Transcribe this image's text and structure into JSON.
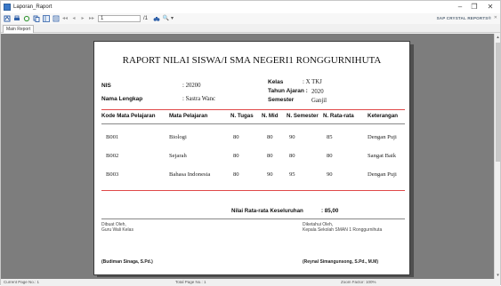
{
  "window": {
    "title": "Laporan_Raport",
    "minimize": "–",
    "maximize": "❐",
    "close": "✕"
  },
  "toolbar": {
    "page_value": "1",
    "page_total": "/1",
    "zoom_symbol": "🔍",
    "zoom_dropdown": "▾",
    "brand": "SAP CRYSTAL REPORTS®",
    "brand_close": "✕"
  },
  "tabs": [
    {
      "label": "Main Report"
    }
  ],
  "report": {
    "title": "RAPORT NILAI SISWA/I SMA NEGERI1 RONGGURNIHUTA",
    "nis_label": "NIS",
    "nis_value": ": 20200",
    "name_label": "Nama Lengkap",
    "name_value": ": Sastra Wanc",
    "kelas_label": "Kelas",
    "kelas_value": ": X TKJ",
    "tahun_label": "Tahun Ajaran :",
    "tahun_value": "2020",
    "semester_label": "Semester",
    "semester_value": "Ganjil",
    "columns": [
      "Kode Mata Pelajaran",
      "Mata Pelajaran",
      "N. Tugas",
      "N. Mid",
      "N. Semester",
      "N. Rata-rata",
      "Keterangan"
    ],
    "rows": [
      {
        "kode": "B001",
        "mapel": "Biologi",
        "tugas": "80",
        "mid": "80",
        "semester": "90",
        "rata": "85",
        "ket": "Dengan Puji"
      },
      {
        "kode": "B002",
        "mapel": "Sejarah",
        "tugas": "80",
        "mid": "80",
        "semester": "80",
        "rata": "80",
        "ket": "Sangat Baik"
      },
      {
        "kode": "B003",
        "mapel": "Bahasa Indonesia",
        "tugas": "80",
        "mid": "90",
        "semester": "95",
        "rata": "90",
        "ket": "Dengan Puji"
      }
    ],
    "avg_label": "Nilai Rata-rata Keseluruhan",
    "avg_value": ":   85,00",
    "left_sig_line1": "Dibuat Oleh,",
    "left_sig_line2": "Guru Wali Kelas",
    "left_sig_name": "(Budiman Sinaga, S.Pd.)",
    "right_sig_line1": "Diketahui Oleh,",
    "right_sig_line2": "Kepala Sekolah SMAN 1 Ronggurnihuta",
    "right_sig_name": "(Reynal Simangunsong, S.Pd., M.M)"
  },
  "status": {
    "left": "Current Page No.: 1",
    "middle": "Total Page No.: 1",
    "right": "Zoom Factor: 100%"
  },
  "colors": {
    "viewer_bg": "#7d7d7d",
    "rule": "#e04848",
    "accent": "#2d5fa8"
  }
}
